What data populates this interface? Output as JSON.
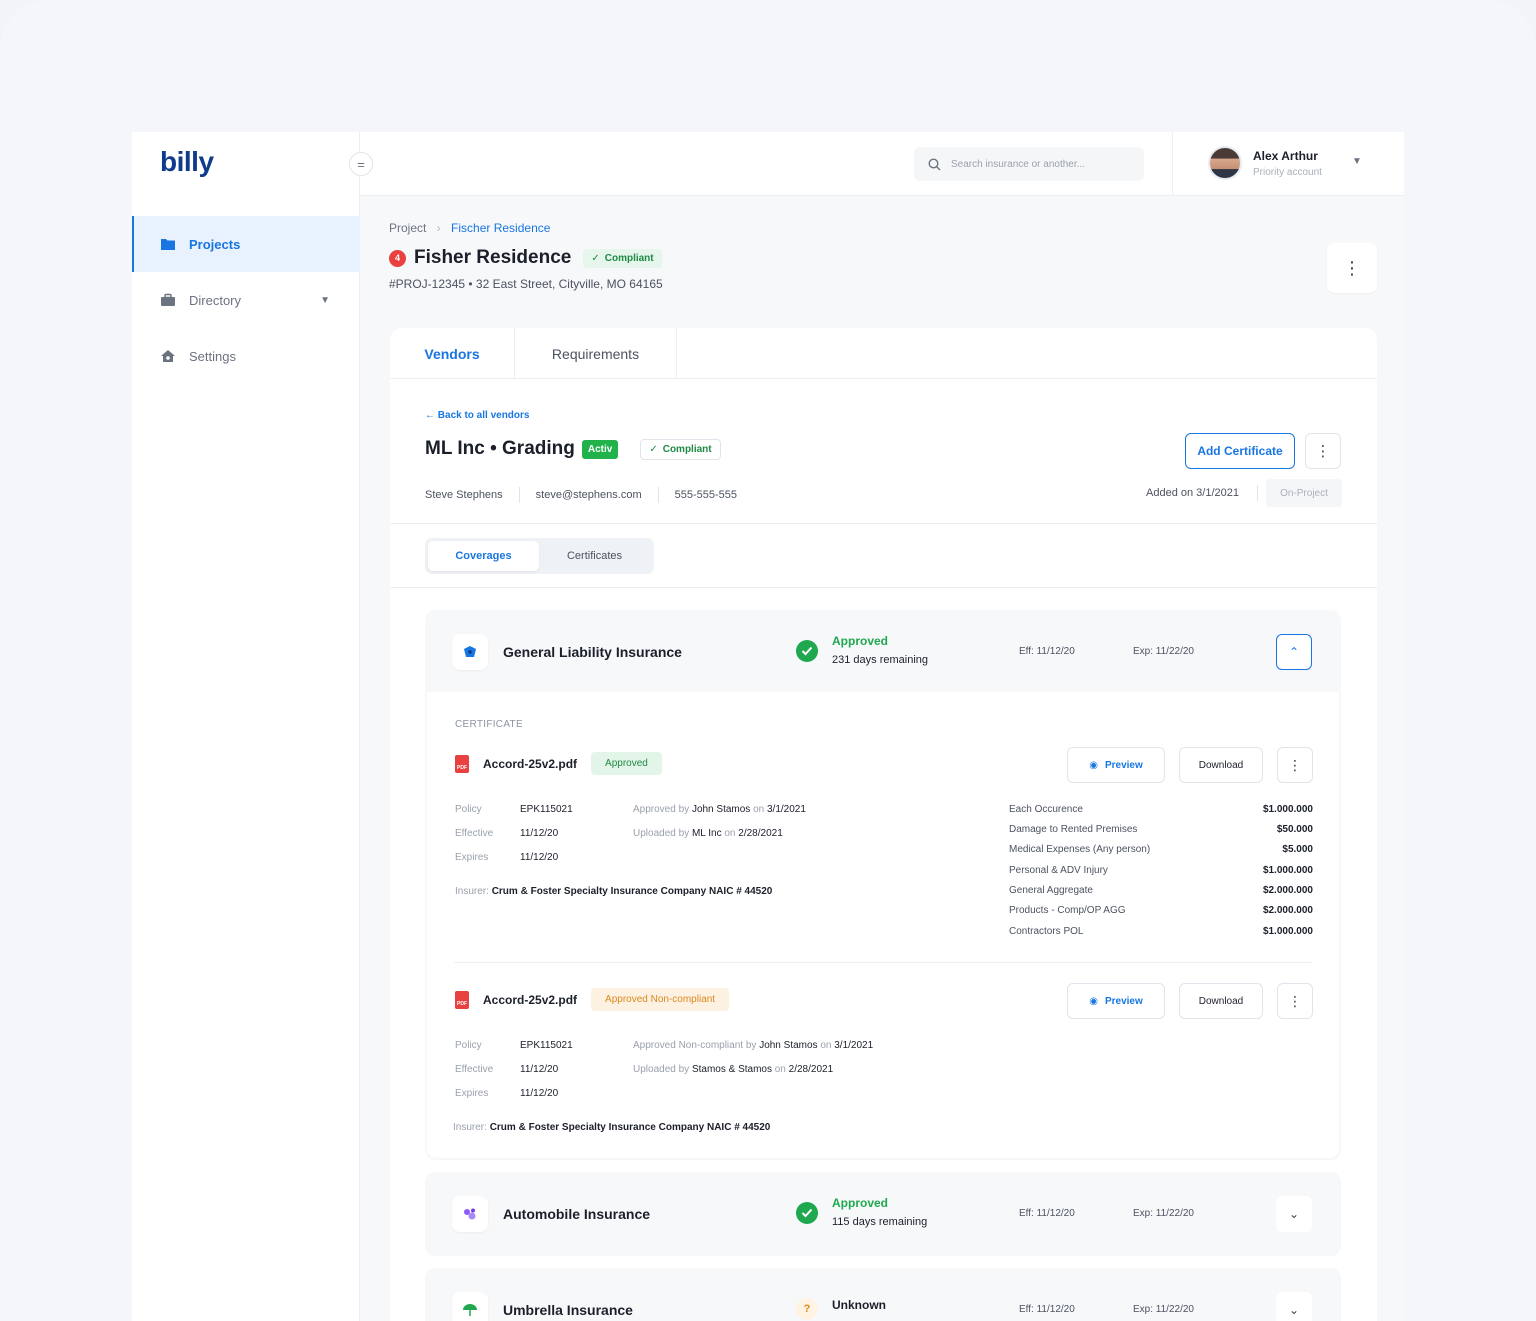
{
  "app": {
    "logo": "billy"
  },
  "sidebar": {
    "items": [
      {
        "label": "Projects",
        "active": true
      },
      {
        "label": "Directory",
        "active": false
      },
      {
        "label": "Settings",
        "active": false
      }
    ]
  },
  "header": {
    "search_placeholder": "Search insurance or another...",
    "user_name": "Alex Arthur",
    "user_sub": "Priority account"
  },
  "breadcrumb": {
    "root": "Project",
    "current": "Fischer Residence"
  },
  "project": {
    "badge_count": "4",
    "title": "Fisher Residence",
    "status": "Compliant",
    "meta": "#PROJ-12345 • 32 East Street, Cityville, MO 64165"
  },
  "tabs": {
    "vendors": "Vendors",
    "requirements": "Requirements"
  },
  "vendor": {
    "back": "Back to all vendors",
    "title": "ML Inc • Grading",
    "active_badge": "Activ",
    "status": "Compliant",
    "contact_name": "Steve Stephens",
    "contact_email": "steve@stephens.com",
    "contact_phone": "555-555-555",
    "add_certificate": "Add Certificate",
    "added_on": "Added on 3/1/2021",
    "tag": "On-Project"
  },
  "subtabs": {
    "coverages": "Coverages",
    "certificates": "Certificates"
  },
  "coverages": [
    {
      "name": "General Liability Insurance",
      "status": "Approved",
      "remaining": "231 days remaining",
      "eff": "Eff: 11/12/20",
      "exp": "Exp: 11/22/20"
    },
    {
      "name": "Automobile Insurance",
      "status": "Approved",
      "remaining": "115 days remaining",
      "eff": "Eff: 11/12/20",
      "exp": "Exp: 11/22/20"
    },
    {
      "name": "Umbrella Insurance",
      "status": "Unknown",
      "status_icon": "?",
      "eff": "Eff: 11/12/20",
      "exp": "Exp: 11/22/20"
    }
  ],
  "certificate_section": {
    "label": "CERTIFICATE"
  },
  "buttons": {
    "preview": "Preview",
    "download": "Download"
  },
  "labels": {
    "policy": "Policy",
    "effective": "Effective",
    "expires": "Expires",
    "insurer": "Insurer:",
    "pdf": "PDF"
  },
  "certificates": [
    {
      "file": "Accord-25v2.pdf",
      "status": "Approved",
      "policy": "EPK115021",
      "effective": "11/12/20",
      "expires": "11/12/20",
      "approved_prefix": "Approved by",
      "approved_by": "John Stamos",
      "on1": "on",
      "approved_date": "3/1/2021",
      "uploaded_prefix": "Uploaded by",
      "uploaded_by": "ML Inc",
      "on2": "on",
      "uploaded_date": "2/28/2021",
      "insurer": "Crum & Foster Specialty Insurance Company NAIC # 44520"
    },
    {
      "file": "Accord-25v2.pdf",
      "status": "Approved Non-compliant",
      "policy": "EPK115021",
      "effective": "11/12/20",
      "expires": "11/12/20",
      "approved_prefix": "Approved Non-compliant by",
      "approved_by": "John Stamos",
      "on1": "on",
      "approved_date": "3/1/2021",
      "uploaded_prefix": "Uploaded by",
      "uploaded_by": "Stamos & Stamos",
      "on2": "on",
      "uploaded_date": "2/28/2021",
      "insurer": "Crum & Foster Specialty Insurance Company NAIC # 44520"
    }
  ],
  "limits": [
    {
      "label": "Each Occurence",
      "value": "$1.000.000"
    },
    {
      "label": "Damage to Rented Premises",
      "value": "$50.000"
    },
    {
      "label": "Medical Expenses (Any person)",
      "value": "$5.000"
    },
    {
      "label": "Personal & ADV Injury",
      "value": "$1.000.000"
    },
    {
      "label": "General Aggregate",
      "value": "$2.000.000"
    },
    {
      "label": "Products - Comp/OP AGG",
      "value": "$2.000.000"
    },
    {
      "label": "Contractors POL",
      "value": "$1.000.000"
    }
  ],
  "colors": {
    "accent": "#1976e1",
    "success": "#1fa84f",
    "danger": "#e94040",
    "warning": "#db8a1f"
  }
}
